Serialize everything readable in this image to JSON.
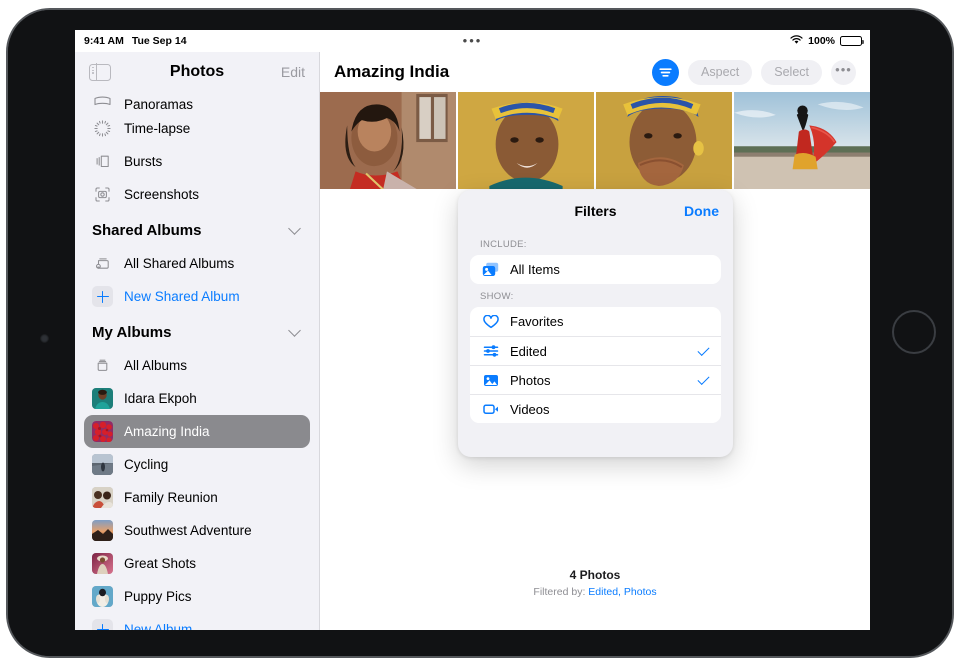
{
  "status_bar": {
    "time": "9:41 AM",
    "date": "Tue Sep 14",
    "multitask_dots": "•••",
    "wifi_icon": "wifi-icon",
    "battery_text": "100%",
    "battery_icon": "battery-full-icon"
  },
  "sidebar": {
    "toggle_icon": "sidebar-toggle-icon",
    "title": "Photos",
    "edit_label": "Edit",
    "media_types": [
      {
        "label": "Panoramas",
        "icon": "panorama-icon",
        "clipped": true
      },
      {
        "label": "Time-lapse",
        "icon": "timelapse-icon"
      },
      {
        "label": "Bursts",
        "icon": "bursts-icon"
      },
      {
        "label": "Screenshots",
        "icon": "screenshots-icon"
      }
    ],
    "shared_albums": {
      "heading": "Shared Albums",
      "chevron_icon": "chevron-down-icon",
      "items": [
        {
          "label": "All Shared Albums",
          "icon": "shared-album-icon"
        }
      ],
      "new_label": "New Shared Album",
      "new_icon": "plus-icon"
    },
    "my_albums": {
      "heading": "My Albums",
      "chevron_icon": "chevron-down-icon",
      "all_albums": {
        "label": "All Albums",
        "icon": "albums-stack-icon"
      },
      "items": [
        {
          "label": "Idara Ekpoh",
          "thumb": "portrait-teal"
        },
        {
          "label": "Amazing India",
          "thumb": "red-flowers",
          "selected": true
        },
        {
          "label": "Cycling",
          "thumb": "cyclist-road"
        },
        {
          "label": "Family Reunion",
          "thumb": "family-group"
        },
        {
          "label": "Southwest Adventure",
          "thumb": "desert-sunset"
        },
        {
          "label": "Great Shots",
          "thumb": "pink-portrait"
        },
        {
          "label": "Puppy Pics",
          "thumb": "white-puppy"
        }
      ],
      "new_label": "New Album",
      "new_icon": "plus-icon"
    }
  },
  "main": {
    "title": "Amazing India",
    "toolbar": {
      "filter_icon": "filter-lines-icon",
      "aspect_label": "Aspect",
      "select_label": "Select",
      "more_icon": "ellipsis-icon"
    },
    "photos": [
      {
        "name": "woman-red-sari-curly-hair"
      },
      {
        "name": "person-yellow-blue-headwrap-smiling"
      },
      {
        "name": "person-yellow-headwrap-hand-over-mouth"
      },
      {
        "name": "dancer-red-sari-silhouette"
      }
    ],
    "footer": {
      "count": "4 Photos",
      "filtered_prefix": "Filtered by: ",
      "filtered_values": "Edited, Photos"
    }
  },
  "filters_popover": {
    "title": "Filters",
    "done_label": "Done",
    "include_label": "INCLUDE:",
    "include_items": [
      {
        "label": "All Items",
        "icon": "all-items-icon",
        "checked": false
      }
    ],
    "show_label": "SHOW:",
    "show_items": [
      {
        "label": "Favorites",
        "icon": "heart-icon",
        "checked": false
      },
      {
        "label": "Edited",
        "icon": "sliders-icon",
        "checked": true
      },
      {
        "label": "Photos",
        "icon": "photo-icon",
        "checked": true
      },
      {
        "label": "Videos",
        "icon": "video-icon",
        "checked": false
      }
    ]
  },
  "colors": {
    "accent": "#0a7cff",
    "sidebar_bg": "#f2f2f7",
    "selected_row": "#8a8a8e",
    "muted_text": "#8e8e93"
  }
}
